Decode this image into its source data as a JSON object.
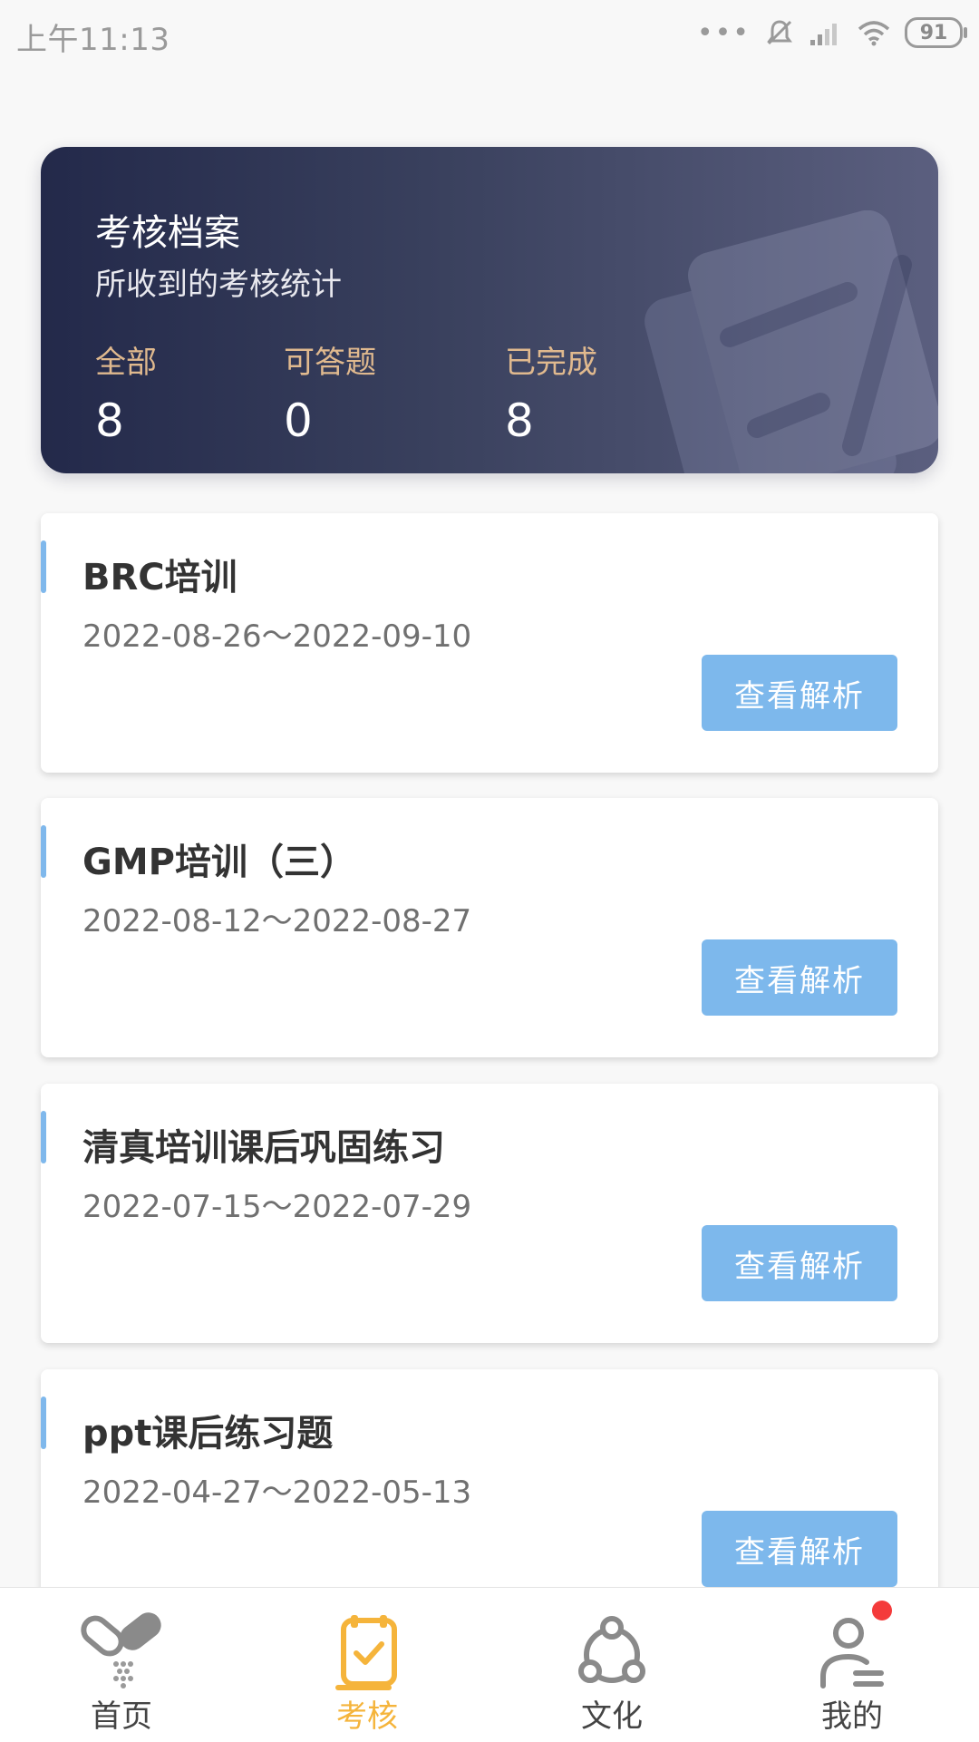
{
  "status_bar": {
    "time": "上午11:13",
    "battery": "91"
  },
  "summary": {
    "title": "考核档案",
    "subtitle": "所收到的考核统计",
    "stats": [
      {
        "label": "全部",
        "value": "8"
      },
      {
        "label": "可答题",
        "value": "0"
      },
      {
        "label": "已完成",
        "value": "8"
      }
    ]
  },
  "exams": [
    {
      "title": "BRC培训",
      "date": "2022-08-26～2022-09-10",
      "button": "查看解析"
    },
    {
      "title": "GMP培训（三）",
      "date": "2022-08-12～2022-08-27",
      "button": "查看解析"
    },
    {
      "title": "清真培训课后巩固练习",
      "date": "2022-07-15～2022-07-29",
      "button": "查看解析"
    },
    {
      "title": "ppt课后练习题",
      "date": "2022-04-27～2022-05-13",
      "button": "查看解析"
    }
  ],
  "nav": {
    "items": [
      {
        "label": "首页",
        "icon": "home-pill-icon"
      },
      {
        "label": "考核",
        "icon": "clipboard-check-icon"
      },
      {
        "label": "文化",
        "icon": "culture-network-icon"
      },
      {
        "label": "我的",
        "icon": "user-profile-icon"
      }
    ],
    "active_color": "#f5b43b",
    "badge_color": "#f43b3b"
  },
  "colors": {
    "accent": "#7db8ec",
    "card_gradient_start": "#23294a",
    "card_gradient_end": "#5b5f7f",
    "stat_label": "#e0b98e"
  }
}
